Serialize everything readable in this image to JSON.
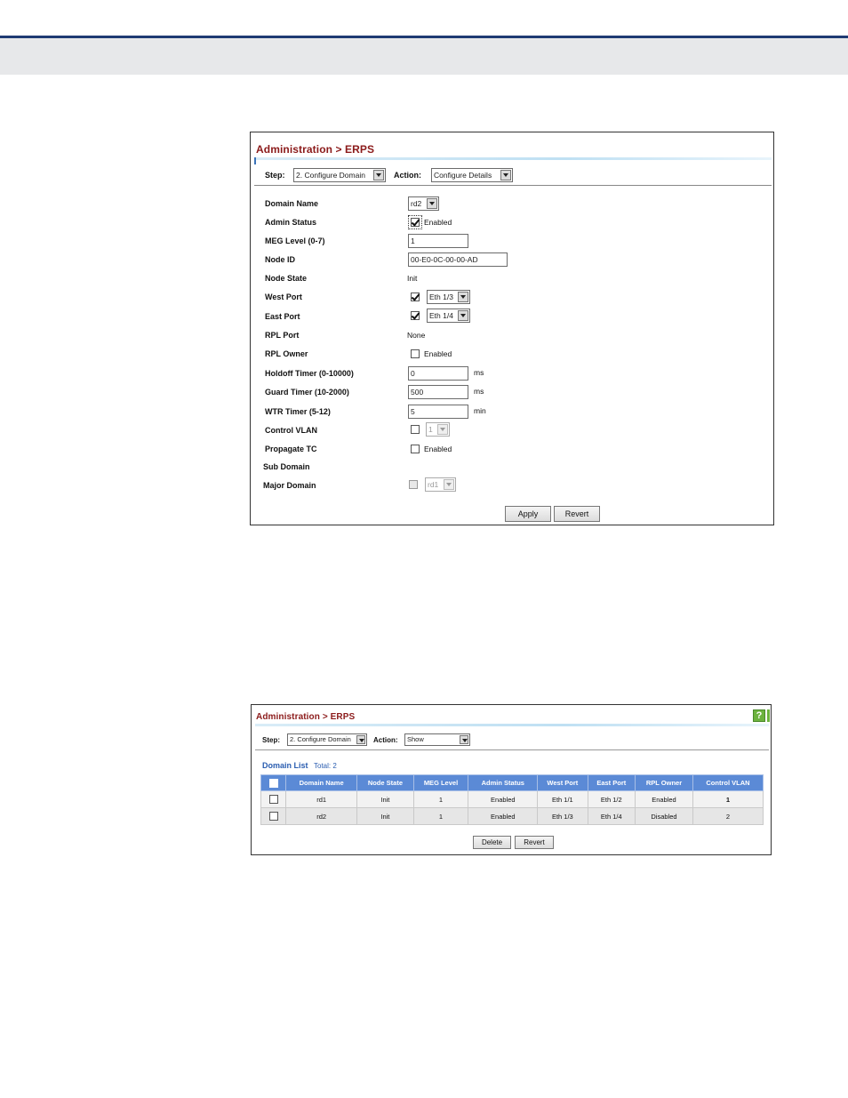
{
  "panel1": {
    "title": "Administration > ERPS",
    "step_label": "Step:",
    "step_value": "2. Configure Domain",
    "action_label": "Action:",
    "action_value": "Configure Details",
    "fields": {
      "domain_name": {
        "label": "Domain Name",
        "value": "rd2"
      },
      "admin_status": {
        "label": "Admin Status",
        "checked": true,
        "text": "Enabled"
      },
      "meg_level": {
        "label": "MEG Level (0-7)",
        "value": "1"
      },
      "node_id": {
        "label": "Node ID",
        "value": "00-E0-0C-00-00-AD"
      },
      "node_state": {
        "label": "Node State",
        "value": "Init"
      },
      "west_port": {
        "label": "West Port",
        "checked": true,
        "value": "Eth 1/3"
      },
      "east_port": {
        "label": "East Port",
        "checked": true,
        "value": "Eth 1/4"
      },
      "rpl_port": {
        "label": "RPL Port",
        "value": "None"
      },
      "rpl_owner": {
        "label": "RPL Owner",
        "checked": false,
        "text": "Enabled"
      },
      "holdoff_timer": {
        "label": "Holdoff Timer (0-10000)",
        "value": "0",
        "unit": "ms"
      },
      "guard_timer": {
        "label": "Guard Timer (10-2000)",
        "value": "500",
        "unit": "ms"
      },
      "wtr_timer": {
        "label": "WTR Timer (5-12)",
        "value": "5",
        "unit": "min"
      },
      "control_vlan": {
        "label": "Control VLAN",
        "checked": false,
        "value": "1"
      },
      "propagate_tc": {
        "label": "Propagate TC",
        "checked": false,
        "text": "Enabled"
      },
      "sub_domain": {
        "label": "Sub Domain"
      },
      "major_domain": {
        "label": "Major Domain",
        "checked": false,
        "value": "rd1"
      }
    },
    "apply_label": "Apply",
    "revert_label": "Revert"
  },
  "panel2": {
    "title": "Administration > ERPS",
    "help_icon": "?",
    "step_label": "Step:",
    "step_value": "2. Configure Domain",
    "action_label": "Action:",
    "action_value": "Show",
    "list_title": "Domain List",
    "list_total": "Total: 2",
    "columns": [
      "Domain Name",
      "Node State",
      "MEG Level",
      "Admin Status",
      "West Port",
      "East Port",
      "RPL Owner",
      "Control VLAN"
    ],
    "rows": [
      [
        "rd1",
        "Init",
        "1",
        "Enabled",
        "Eth 1/1",
        "Eth 1/2",
        "Enabled",
        "1"
      ],
      [
        "rd2",
        "Init",
        "1",
        "Enabled",
        "Eth 1/3",
        "Eth 1/4",
        "Disabled",
        "2"
      ]
    ],
    "delete_label": "Delete",
    "revert_label": "Revert"
  }
}
